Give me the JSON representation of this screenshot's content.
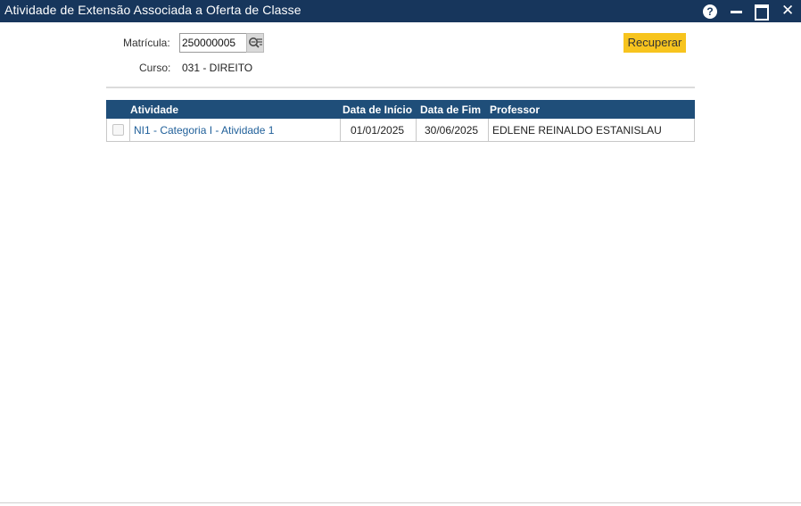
{
  "window": {
    "title": "Atividade de Extensão Associada a Oferta de Classe",
    "help_label": "?",
    "close_label": "✕"
  },
  "form": {
    "matricula_label": "Matrícula:",
    "matricula_value": "250000005",
    "curso_label": "Curso:",
    "curso_value": "031 - DIREITO",
    "recuperar_label": "Recuperar"
  },
  "table": {
    "headers": {
      "atividade": "Atividade",
      "data_inicio": "Data de Início",
      "data_fim": "Data de Fim",
      "professor": "Professor"
    },
    "rows": [
      {
        "checked": false,
        "atividade": "NI1 - Categoria I - Atividade 1",
        "data_inicio": "01/01/2025",
        "data_fim": "30/06/2025",
        "professor": "EDLENE REINALDO ESTANISLAU"
      }
    ]
  },
  "colors": {
    "titlebar": "#17365c",
    "table_header": "#1f4e79",
    "accent_button": "#f7c41e",
    "link": "#1f5f99"
  },
  "icons": {
    "lookup": "search-list-icon",
    "help": "help-icon",
    "minimize": "minimize-icon",
    "maximize": "maximize-icon",
    "close": "close-icon"
  }
}
